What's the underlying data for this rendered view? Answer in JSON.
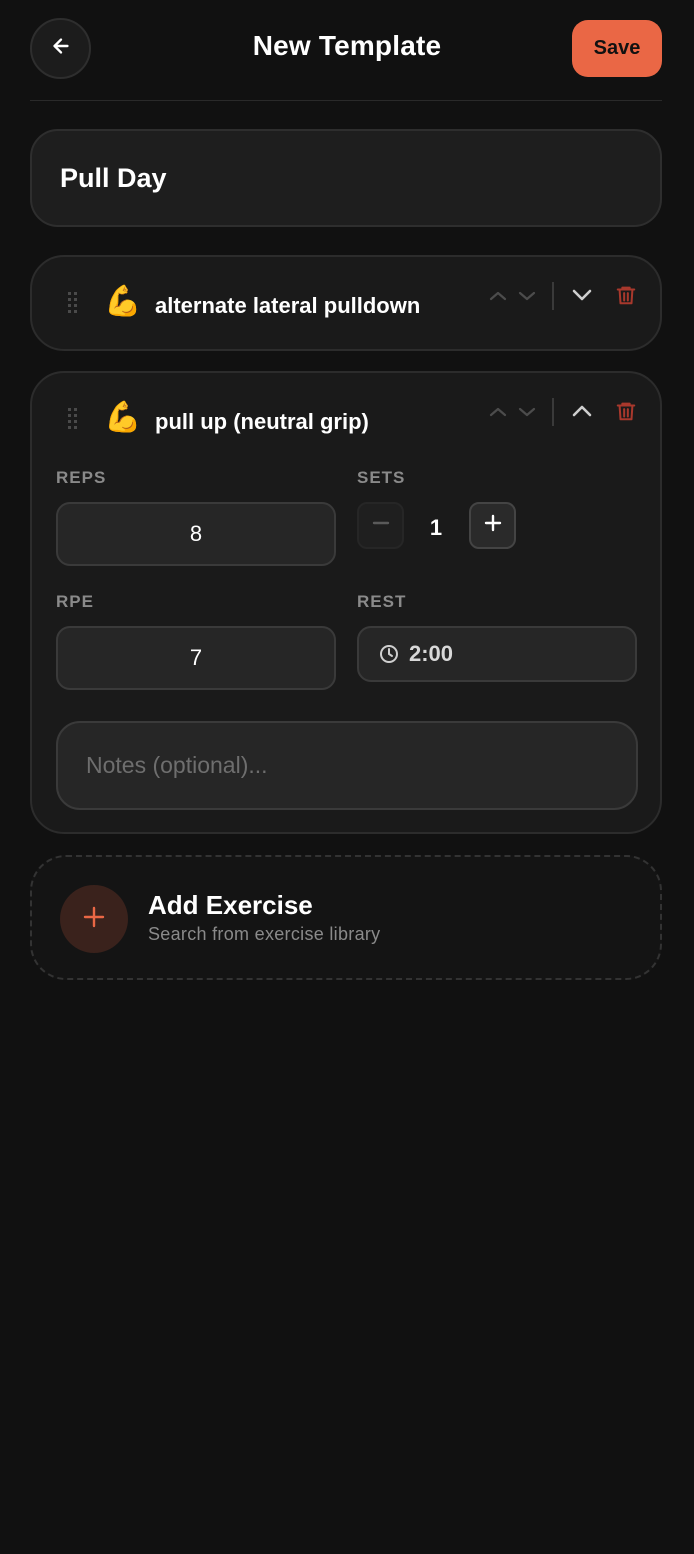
{
  "header": {
    "title": "New Template",
    "save_label": "Save",
    "back_icon": "arrow-left-icon"
  },
  "template": {
    "name": "Pull Day"
  },
  "exercises": [
    {
      "name": "alternate lateral pulldown",
      "emoji": "💪",
      "expanded": false
    },
    {
      "name": "pull up (neutral grip)",
      "emoji": "💪",
      "expanded": true,
      "reps_label": "REPS",
      "reps_value": "8",
      "sets_label": "SETS",
      "sets_value": "1",
      "rpe_label": "RPE",
      "rpe_value": "7",
      "rest_label": "REST",
      "rest_value": "2:00",
      "notes_placeholder": "Notes (optional)..."
    }
  ],
  "add_exercise": {
    "title": "Add Exercise",
    "subtitle": "Search from exercise library"
  },
  "colors": {
    "accent": "#ea6745",
    "delete": "#a8382c",
    "background": "#111111"
  }
}
